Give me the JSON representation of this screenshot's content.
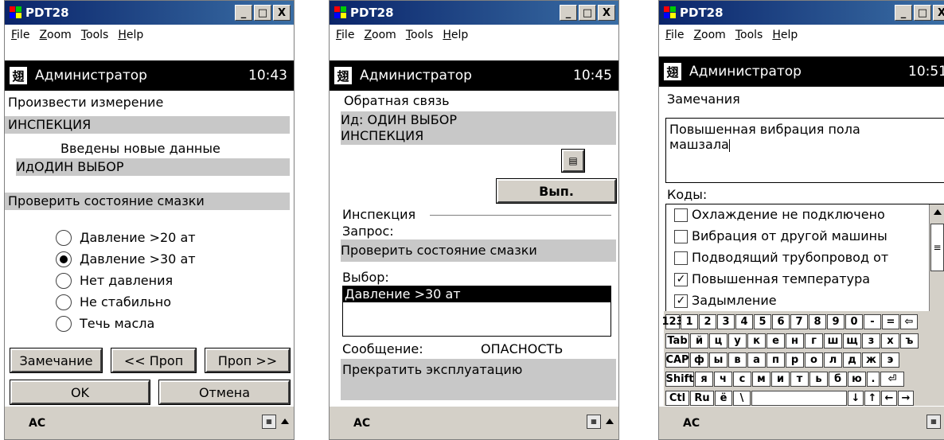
{
  "app": {
    "title": "PDT28",
    "menu": [
      "File",
      "Zoom",
      "Tools",
      "Help"
    ],
    "user": "Администратор",
    "taskbar_label": "AC",
    "minimize": "_",
    "maximize": "□",
    "close": "X",
    "header_icon": "翅",
    "kb_icon": "keyboard-icon"
  },
  "s1": {
    "time": "10:43",
    "title": "Произвести измерение",
    "section": "ИНСПЕКЦИЯ",
    "note": "Введены новые данные",
    "id_label": "Ид",
    "id_value": "ОДИН ВЫБОР",
    "question": "Проверить состояние смазки",
    "options": [
      "Давление >20 ат",
      "Давление >30 ат",
      "Нет давления",
      "Не стабильно",
      "Течь масла"
    ],
    "selected_index": 1,
    "btn_remark": "Замечание",
    "btn_prev": "<< Проп",
    "btn_next": "Проп >>",
    "btn_ok": "OK",
    "btn_cancel": "Отмена"
  },
  "s2": {
    "time": "10:45",
    "title": "Обратная связь",
    "id_line": "Ид: ОДИН ВЫБОР",
    "section": "ИНСПЕКЦИЯ",
    "btn_exec": "Вып.",
    "group_label": "Инспекция",
    "request_label": "Запрос:",
    "request_value": "Проверить состояние смазки",
    "choice_label": "Выбор:",
    "choice_value": "Давление >30 ат",
    "message_label": "Сообщение:",
    "message_value": "ОПАСНОСТЬ",
    "action_value": "Прекратить эксплуатацию"
  },
  "s3": {
    "time": "10:51",
    "title": "Замечания",
    "note_line1": "Повышенная вибрация пола",
    "note_line2": "машзала",
    "codes_label": "Коды:",
    "codes": [
      {
        "label": "Охлаждение не подключено",
        "checked": false
      },
      {
        "label": "Вибрация от другой машины",
        "checked": false
      },
      {
        "label": "Подводящий трубопровод от",
        "checked": false
      },
      {
        "label": "Повышенная температура",
        "checked": true
      },
      {
        "label": "Задымление",
        "checked": true
      }
    ],
    "keyboard": {
      "row1": [
        "123",
        "1",
        "2",
        "3",
        "4",
        "5",
        "6",
        "7",
        "8",
        "9",
        "0",
        "-",
        "=",
        "⇦"
      ],
      "row2": [
        "Tab",
        "й",
        "ц",
        "у",
        "к",
        "е",
        "н",
        "г",
        "ш",
        "щ",
        "з",
        "х",
        "ъ"
      ],
      "row3": [
        "CAP",
        "ф",
        "ы",
        "в",
        "а",
        "п",
        "р",
        "о",
        "л",
        "д",
        "ж",
        "э"
      ],
      "row4": [
        "Shift",
        "я",
        "ч",
        "с",
        "м",
        "и",
        "т",
        "ь",
        "б",
        "ю",
        ".",
        "⏎"
      ],
      "row5": [
        "Ctl",
        "Ru",
        "ё",
        "\\",
        "",
        "↓",
        "↑",
        "←",
        "→"
      ]
    }
  }
}
